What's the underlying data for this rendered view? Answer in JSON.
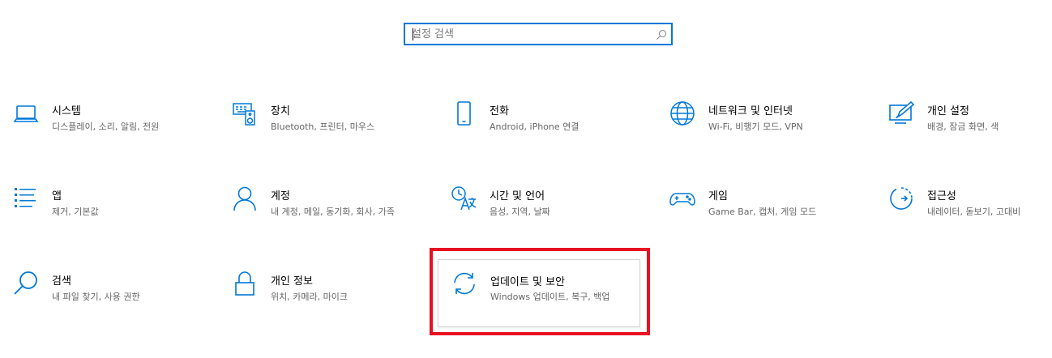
{
  "search": {
    "placeholder": "설정 검색",
    "value": ""
  },
  "colors": {
    "accent": "#0078d7",
    "highlight": "#e81123"
  },
  "tiles": [
    {
      "title": "시스템",
      "desc": "디스플레이, 소리, 알림, 전원",
      "icon": "laptop-icon"
    },
    {
      "title": "장치",
      "desc": "Bluetooth, 프린터, 마우스",
      "icon": "devices-icon"
    },
    {
      "title": "전화",
      "desc": "Android, iPhone 연결",
      "icon": "phone-icon"
    },
    {
      "title": "네트워크 및 인터넷",
      "desc": "Wi-Fi, 비행기 모드, VPN",
      "icon": "globe-icon"
    },
    {
      "title": "개인 설정",
      "desc": "배경, 잠금 화면, 색",
      "icon": "personalization-icon"
    },
    {
      "title": "앱",
      "desc": "제거, 기본값",
      "icon": "apps-list-icon"
    },
    {
      "title": "계정",
      "desc": "내 계정, 메일, 동기화, 회사, 가족",
      "icon": "person-icon"
    },
    {
      "title": "시간 및 언어",
      "desc": "음성, 지역, 날짜",
      "icon": "time-language-icon"
    },
    {
      "title": "게임",
      "desc": "Game Bar, 캡처, 게임 모드",
      "icon": "gamepad-icon"
    },
    {
      "title": "접근성",
      "desc": "내레이터, 돋보기, 고대비",
      "icon": "accessibility-icon"
    },
    {
      "title": "검색",
      "desc": "내 파일 찾기, 사용 권한",
      "icon": "search-icon"
    },
    {
      "title": "개인 정보",
      "desc": "위치, 카메라, 마이크",
      "icon": "lock-icon"
    },
    {
      "title": "업데이트 및 보안",
      "desc": "Windows 업데이트, 복구, 백업",
      "icon": "sync-icon"
    }
  ]
}
